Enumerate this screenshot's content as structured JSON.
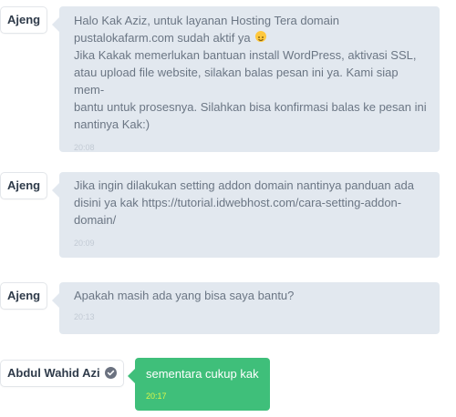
{
  "messages": [
    {
      "sender": "Ajeng",
      "lines": [
        "Halo Kak Aziz, untuk layanan Hosting Tera domain",
        "pustalokafarm.com sudah aktif ya",
        "Jika Kakak memerlukan bantuan install WordPress, aktivasi SSL,",
        "atau upload file website, silakan balas pesan ini ya. Kami siap mem-",
        "bantu untuk prosesnya. Silahkan bisa konfirmasi balas ke pesan ini",
        "nantinya Kak:)"
      ],
      "time": "20:08"
    },
    {
      "sender": "Ajeng",
      "lines": [
        "Jika ingin dilakukan setting addon domain nantinya panduan ada",
        "disini ya kak https://tutorial.idwebhost.com/cara-setting-addon-",
        "domain/"
      ],
      "time": "20:09"
    },
    {
      "sender": "Ajeng",
      "lines": [
        "Apakah masih ada yang bisa saya bantu?"
      ],
      "time": "20:13"
    },
    {
      "sender": "Abdul Wahid Azi",
      "lines": [
        "sementara cukup kak"
      ],
      "time": "20:17",
      "verified_icon": "check-circle-icon"
    }
  ],
  "colors": {
    "agent_bubble": "#e2e8ef",
    "user_bubble": "#3fbf7a",
    "user_time": "#d9f54b"
  }
}
